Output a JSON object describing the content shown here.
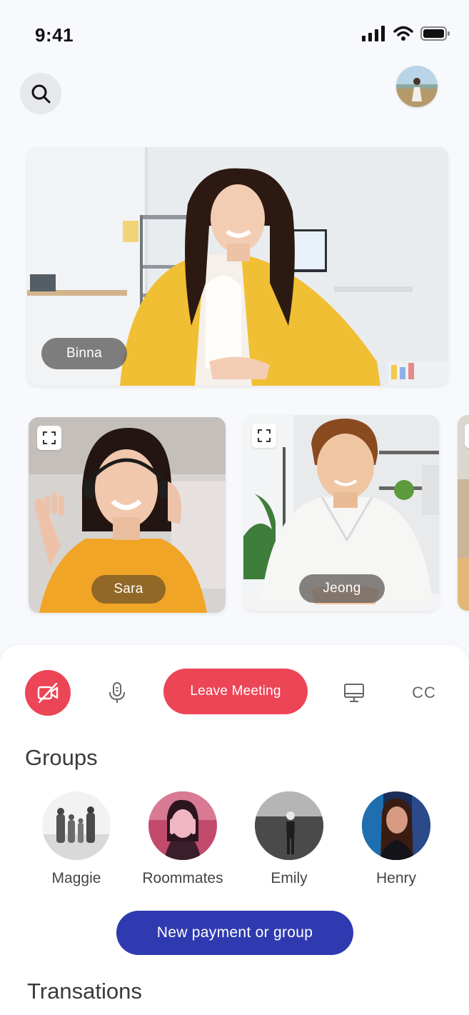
{
  "status_bar": {
    "time": "9:41"
  },
  "main_speaker": {
    "name": "Binna"
  },
  "participants": [
    {
      "name": "Sara"
    },
    {
      "name": "Jeong"
    }
  ],
  "controls": {
    "camera_icon": "video-off-icon",
    "mic_icon": "microphone-icon",
    "leave_label": "Leave Meeting",
    "screen_icon": "monitor-icon",
    "captions_label": "CC",
    "accent_color": "#ec4556"
  },
  "groups": {
    "title": "Groups",
    "items": [
      {
        "label": "Maggie"
      },
      {
        "label": "Roommates"
      },
      {
        "label": "Emily"
      },
      {
        "label": "Henry"
      }
    ]
  },
  "new_button": {
    "label": "New payment or group",
    "color": "#2f3ab0"
  },
  "transactions": {
    "title": "Transations"
  }
}
